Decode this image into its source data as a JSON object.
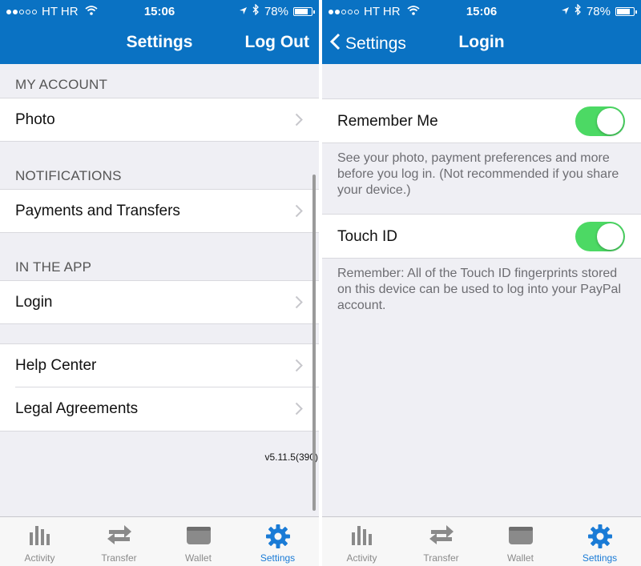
{
  "status": {
    "carrier": "HT HR",
    "time": "15:06",
    "battery": "78%",
    "battery_level": 0.78
  },
  "left": {
    "nav_title": "Settings",
    "logout_label": "Log Out",
    "sections": [
      {
        "header": "MY ACCOUNT",
        "items": [
          "Photo"
        ]
      },
      {
        "header": "NOTIFICATIONS",
        "items": [
          "Payments and Transfers"
        ]
      },
      {
        "header": "IN THE APP",
        "items": [
          "Login"
        ]
      },
      {
        "header": "",
        "items": [
          "Help Center",
          "Legal Agreements"
        ]
      }
    ],
    "version": "v5.11.5(390)"
  },
  "right": {
    "back_label": "Settings",
    "nav_title": "Login",
    "remember_me": {
      "label": "Remember Me",
      "on": true,
      "note": "See your photo, payment preferences and more before you log in. (Not recommended if you share your device.)"
    },
    "touch_id": {
      "label": "Touch ID",
      "on": true,
      "note": "Remember: All of the Touch ID fingerprints stored on this device can be used to log into your PayPal account."
    }
  },
  "tabs": [
    {
      "label": "Activity",
      "icon": "activity-bars-icon",
      "active": false
    },
    {
      "label": "Transfer",
      "icon": "transfer-arrows-icon",
      "active": false
    },
    {
      "label": "Wallet",
      "icon": "wallet-icon",
      "active": false
    },
    {
      "label": "Settings",
      "icon": "gear-icon",
      "active": true
    }
  ],
  "colors": {
    "brand": "#0a72c3",
    "active_tab": "#1a7bd6",
    "toggle_on": "#4cd964"
  }
}
